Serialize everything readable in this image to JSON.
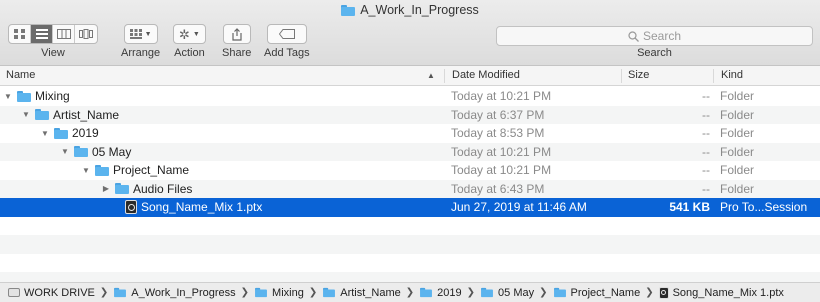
{
  "window": {
    "title": "A_Work_In_Progress"
  },
  "toolbar": {
    "view_label": "View",
    "arrange_label": "Arrange",
    "action_label": "Action",
    "share_label": "Share",
    "add_tags_label": "Add Tags",
    "search_placeholder": "Search",
    "search_label": "Search"
  },
  "columns": {
    "name": "Name",
    "date_modified": "Date Modified",
    "size": "Size",
    "kind": "Kind"
  },
  "rows": [
    {
      "name": "Mixing",
      "date": "Today at 10:21 PM",
      "size": "--",
      "kind": "Folder"
    },
    {
      "name": "Artist_Name",
      "date": "Today at 6:37 PM",
      "size": "--",
      "kind": "Folder"
    },
    {
      "name": "2019",
      "date": "Today at 8:53 PM",
      "size": "--",
      "kind": "Folder"
    },
    {
      "name": "05 May",
      "date": "Today at 10:21 PM",
      "size": "--",
      "kind": "Folder"
    },
    {
      "name": "Project_Name",
      "date": "Today at 10:21 PM",
      "size": "--",
      "kind": "Folder"
    },
    {
      "name": "Audio Files",
      "date": "Today at 6:43 PM",
      "size": "--",
      "kind": "Folder"
    },
    {
      "name": "Song_Name_Mix 1.ptx",
      "date": "Jun 27, 2019 at 11:46 AM",
      "size": "541 KB",
      "kind": "Pro To...Session"
    }
  ],
  "pathbar": [
    "WORK DRIVE",
    "A_Work_In_Progress",
    "Mixing",
    "Artist_Name",
    "2019",
    "05 May",
    "Project_Name",
    "Song_Name_Mix 1.ptx"
  ],
  "colors": {
    "selection": "#0a63d6",
    "folder": "#5bb4ee"
  }
}
